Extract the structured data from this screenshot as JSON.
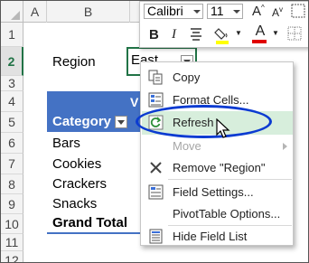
{
  "columns": [
    "A",
    "B"
  ],
  "rows": [
    "1",
    "2",
    "3",
    "4",
    "5",
    "6",
    "7",
    "8",
    "9",
    "10",
    "11",
    "12"
  ],
  "filter": {
    "label": "Region",
    "value": "East"
  },
  "pivot": {
    "header_partial": "V",
    "category_header": "Category",
    "items": [
      "Bars",
      "Cookies",
      "Crackers",
      "Snacks"
    ],
    "grand_total": "Grand Total"
  },
  "mini_toolbar": {
    "font_name": "Calibri",
    "font_size": "11",
    "grow_font": "A",
    "shrink_font": "A",
    "bold": "B",
    "italic": "I",
    "font_color_letter": "A",
    "font_color": "#e00000",
    "fill_color": "#ffff00"
  },
  "context_menu": {
    "items": [
      {
        "label": "Copy",
        "icon": "copy-icon",
        "enabled": true
      },
      {
        "label": "Format Cells...",
        "icon": "format-cells-icon",
        "enabled": true
      },
      {
        "label": "Refresh",
        "icon": "refresh-icon",
        "enabled": true,
        "highlighted": true
      },
      {
        "label": "Move",
        "icon": "",
        "enabled": false,
        "submenu": true
      },
      {
        "label": "Remove \"Region\"",
        "icon": "remove-x-icon",
        "enabled": true
      },
      {
        "label": "Field Settings...",
        "icon": "field-settings-icon",
        "enabled": true
      },
      {
        "label": "PivotTable Options...",
        "icon": "",
        "enabled": true
      },
      {
        "label": "Hide Field List",
        "icon": "field-list-icon",
        "enabled": true
      }
    ]
  },
  "colors": {
    "pivot_header": "#4472c4",
    "selection_border": "#217346",
    "annotation_oval": "#0b3bd1",
    "menu_highlight": "#d7eedc"
  }
}
